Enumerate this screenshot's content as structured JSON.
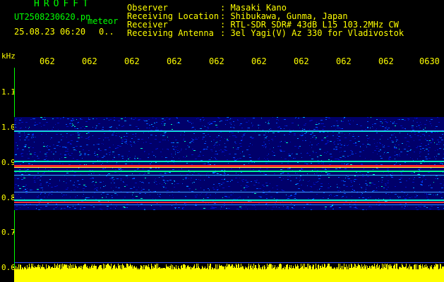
{
  "header": {
    "brand": "HROFFT",
    "filename": "UT2508230620.pn",
    "mode": "meteor",
    "datetime": "25.08.23 06:20",
    "datetime_suffix": "0..",
    "observer_key": "Observer",
    "observer_val": ": Masaki Kano",
    "location_key": "Receiving Location",
    "location_val": ": Shibukawa, Gunma, Japan",
    "receiver_key": "Receiver",
    "receiver_val": ": RTL-SDR SDR# 43dB L15 103.2MHz CW",
    "antenna_key": "Receiving Antenna",
    "antenna_val": ": 3el Yagi(V) Az 330 for Vladivostok"
  },
  "axes": {
    "y_unit": "kHz",
    "y_ticks": [
      "1.1",
      "1.0",
      "0.9",
      "0.8",
      "0.7",
      "0.6"
    ],
    "x_ticks": [
      "062",
      "062",
      "062",
      "062",
      "062",
      "062",
      "062",
      "062",
      "062",
      "0630"
    ]
  },
  "colors": {
    "label": "#ffff00",
    "header_text": "#ffffff",
    "brand": "#00ff00",
    "band_bg": "#000080",
    "strong_line": "#ff2020",
    "mid_line": "#00ffc0"
  }
}
